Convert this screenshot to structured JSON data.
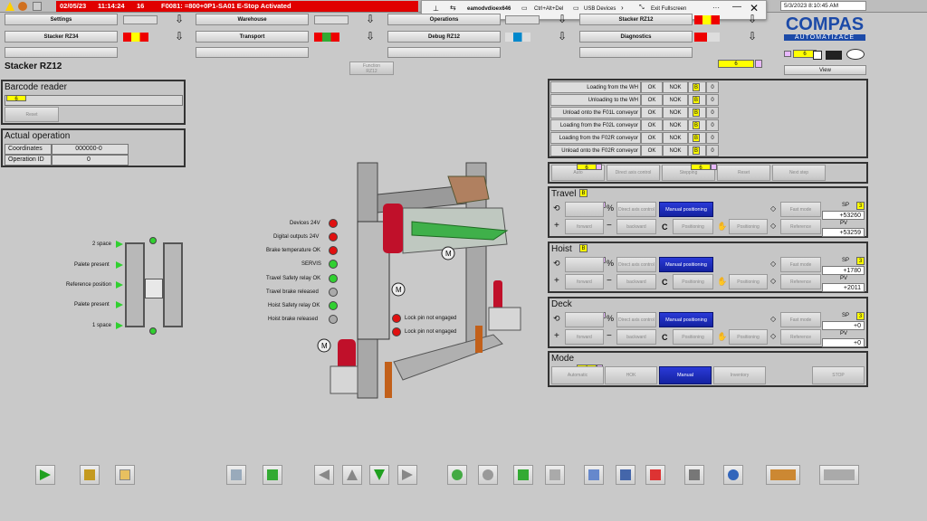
{
  "status": {
    "date": "02/05/23",
    "time": "11:14:24",
    "count": "16",
    "alarm": "F0081: =800+0P1-SA01 E-Stop Activated"
  },
  "remote": {
    "host": "eamodvdioex646",
    "cad": "Ctrl+Alt+Del",
    "usb": "USB Devices",
    "exit": "Exit Fullscreen"
  },
  "clock": "5/3/2023 8:10:45 AM",
  "logo": {
    "name": "COMPAS",
    "sub": "AUTOMATIZACE"
  },
  "view_label": "View",
  "nav": [
    {
      "label": "Settings"
    },
    {
      "label": "Warehouse"
    },
    {
      "label": "Operations"
    },
    {
      "label": "Stacker RZ12"
    },
    {
      "label": "Stacker RZ34"
    },
    {
      "label": "Transport"
    },
    {
      "label": "Debug RZ12"
    },
    {
      "label": "Diagnostics"
    }
  ],
  "small_vals": {
    "v6": "6",
    "v8": "8"
  },
  "page_title": "Stacker RZ12",
  "function_btn": "Function\nRZ12",
  "barcode": {
    "title": "Barcode reader",
    "reset": "Reset"
  },
  "actual": {
    "title": "Actual operation",
    "rows": [
      {
        "k": "Coordinates",
        "v": "000000-0"
      },
      {
        "k": "Operation ID",
        "v": "0"
      }
    ]
  },
  "spaces": [
    "2 space",
    "Palete present",
    "Reference position",
    "Palete present",
    "1 space"
  ],
  "signals": [
    "Devices 24V",
    "Digital outputs 24V",
    "Brake temperature OK",
    "SERVIS",
    "Travel Safety relay OK",
    "Travel brake released",
    "Hoist Safety relay OK",
    "Hoist brake released"
  ],
  "locks": [
    "Lock pin not engaged",
    "Lock pin not engaged"
  ],
  "loads": [
    {
      "label": "Loading from the WH",
      "ok": "OK",
      "nok": "NOK",
      "b": "B",
      "n": "0"
    },
    {
      "label": "Unloading to the WH",
      "ok": "OK",
      "nok": "NOK",
      "b": "B",
      "n": "0"
    },
    {
      "label": "Unload onto the F01L conveyor",
      "ok": "OK",
      "nok": "NOK",
      "b": "B",
      "n": "0"
    },
    {
      "label": "Loading from the F02L conveyor",
      "ok": "OK",
      "nok": "NOK",
      "b": "B",
      "n": "0"
    },
    {
      "label": "Loading from the F02R conveyor",
      "ok": "OK",
      "nok": "NOK",
      "b": "B",
      "n": "0"
    },
    {
      "label": "Unload onto the F02R conveyor",
      "ok": "OK",
      "nok": "NOK",
      "b": "B",
      "n": "0"
    }
  ],
  "ops": [
    "Auto",
    "Direct axis control",
    "Stepping",
    "Reset",
    "Next step"
  ],
  "axes": [
    {
      "title": "Travel",
      "b": "B",
      "sp": "+53260",
      "pv": "+53259"
    },
    {
      "title": "Hoist",
      "b": "B",
      "sp": "+1780",
      "pv": "+2011"
    },
    {
      "title": "Deck",
      "sp": "+0",
      "pv": "+0"
    }
  ],
  "axis_btns": {
    "direct": "Direct axis control",
    "manual": "Manual positioning",
    "forward": "forward",
    "backward": "backward",
    "positioning": "Positioning",
    "reference": "Reference",
    "axis": "Axis",
    "position": "Fast mode",
    "sp": "SP",
    "pv": "PV",
    "three": "3"
  },
  "mode": {
    "title": "Mode",
    "items": [
      "Automatic",
      "HOK",
      "Manual",
      "Inventory",
      "STOP"
    ]
  },
  "colors": {
    "alarm": "#e00000",
    "manual": "#1a2ab8",
    "yellow": "#ffff00"
  }
}
